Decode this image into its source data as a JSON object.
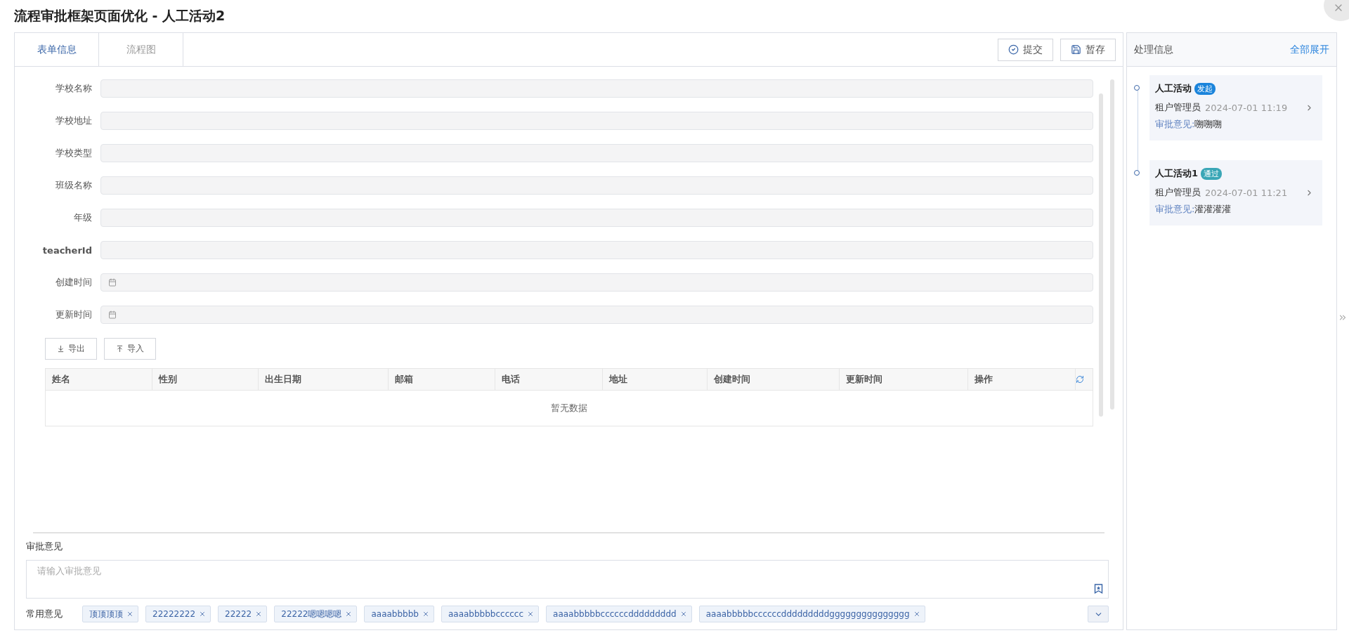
{
  "title": "流程审批框架页面优化 - 人工活动2",
  "tabs": [
    {
      "label": "表单信息",
      "selected": true
    },
    {
      "label": "流程图",
      "selected": false
    }
  ],
  "actions": [
    {
      "kind": "submit",
      "label": "提交"
    },
    {
      "kind": "save",
      "label": "暂存"
    }
  ],
  "form": {
    "fields": [
      {
        "label": "学校名称",
        "kind": "text"
      },
      {
        "label": "学校地址",
        "kind": "text"
      },
      {
        "label": "学校类型",
        "kind": "text"
      },
      {
        "label": "班级名称",
        "kind": "text"
      },
      {
        "label": "年级",
        "kind": "text"
      },
      {
        "label": "teacherId",
        "kind": "text"
      },
      {
        "label": "创建时间",
        "kind": "date"
      },
      {
        "label": "更新时间",
        "kind": "date"
      }
    ]
  },
  "table_tools": [
    {
      "kind": "export",
      "label": "导出"
    },
    {
      "kind": "import",
      "label": "导入"
    }
  ],
  "table": {
    "columns": [
      "姓名",
      "性别",
      "出生日期",
      "邮箱",
      "电话",
      "地址",
      "创建时间",
      "更新时间",
      "操作"
    ],
    "empty_text": "暂无数据"
  },
  "opinion": {
    "label": "审批意见",
    "placeholder": "请输入审批意见"
  },
  "common": {
    "label": "常用意见",
    "tags": [
      "顶顶顶顶",
      "22222222",
      "22222",
      "22222嗯嗯嗯嗯",
      "aaaabbbbb",
      "aaaabbbbbcccccc",
      "aaaabbbbbccccccddddddddd",
      "aaaabbbbbccccccdddddddddggggggggggggggg"
    ]
  },
  "process": {
    "title": "处理信息",
    "expand_all": "全部展开",
    "items": [
      {
        "name": "人工活动",
        "status": "发起",
        "color": "#1b84db",
        "user": "租户管理员",
        "time": "2024-07-01 11:19",
        "opinion_label": "审批意见:",
        "opinion": "嗍嗍嗍"
      },
      {
        "name": "人工活动1",
        "status": "通过",
        "color": "#3aa6b6",
        "user": "租户管理员",
        "time": "2024-07-01 11:21",
        "opinion_label": "审批意见:",
        "opinion": "灌灌灌灌"
      }
    ]
  }
}
